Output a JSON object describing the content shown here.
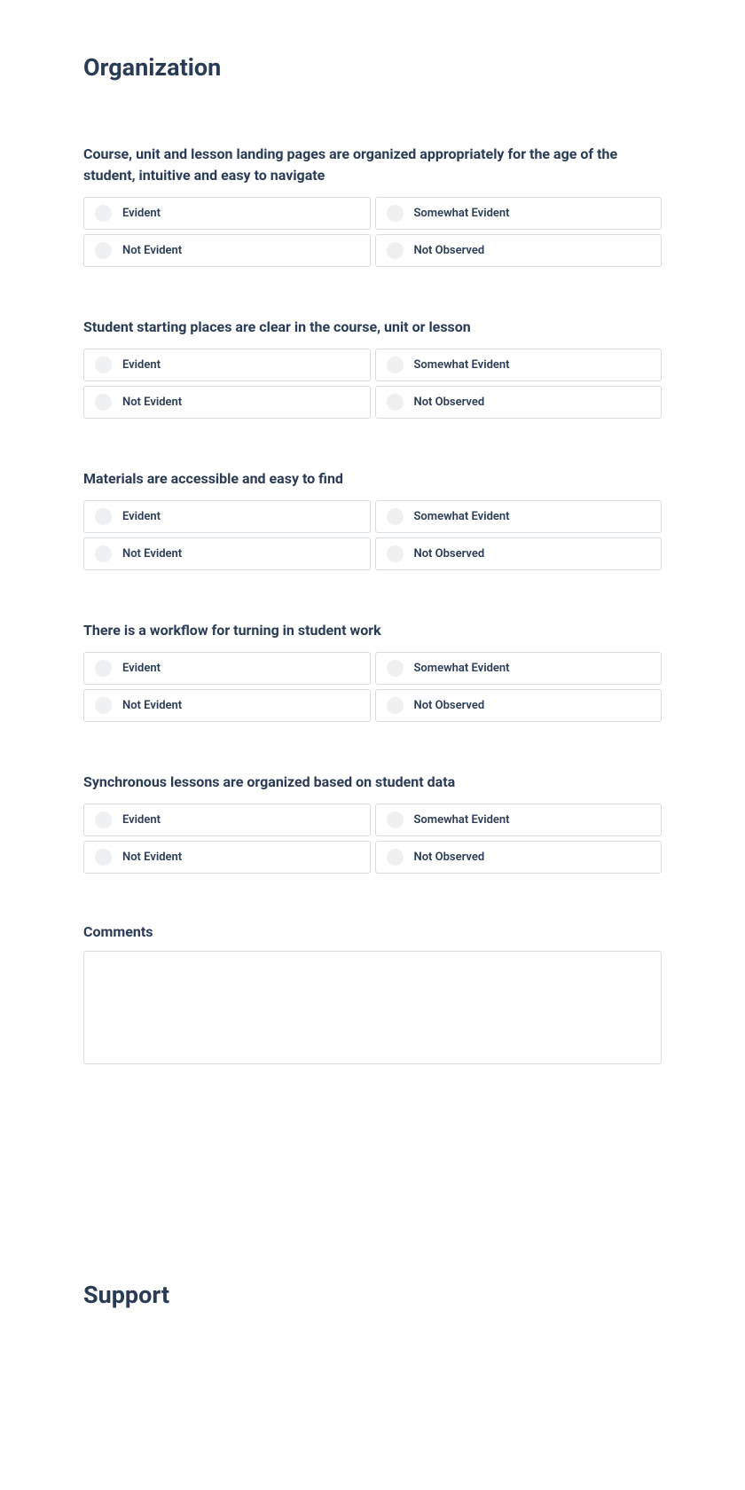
{
  "sections": [
    {
      "title": "Organization",
      "questions": [
        {
          "text": "Course, unit and lesson landing pages are organized appropriately for the age of the student, intuitive and easy to navigate",
          "options": [
            "Evident",
            "Somewhat Evident",
            "Not Evident",
            "Not Observed"
          ]
        },
        {
          "text": "Student starting places are clear in the course, unit or lesson",
          "options": [
            "Evident",
            "Somewhat Evident",
            "Not Evident",
            "Not Observed"
          ]
        },
        {
          "text": "Materials are accessible and easy to find",
          "options": [
            "Evident",
            "Somewhat Evident",
            "Not Evident",
            "Not Observed"
          ]
        },
        {
          "text": "There is a workflow for turning in student work",
          "options": [
            "Evident",
            "Somewhat Evident",
            "Not Evident",
            "Not Observed"
          ]
        },
        {
          "text": "Synchronous lessons are organized based on student data",
          "options": [
            "Evident",
            "Somewhat Evident",
            "Not Evident",
            "Not Observed"
          ]
        }
      ],
      "comments_label": "Comments"
    },
    {
      "title": "Support"
    }
  ]
}
